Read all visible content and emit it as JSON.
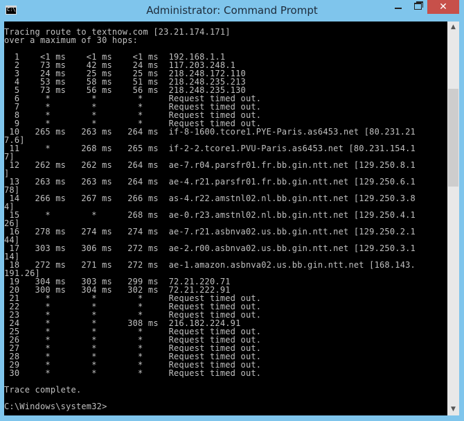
{
  "window": {
    "title": "Administrator: Command Prompt",
    "icon_label": "C:\\",
    "minimize_icon": "minimize-icon",
    "maximize_icon": "maximize-icon",
    "close_glyph": "✕"
  },
  "console": {
    "lines": [
      "Tracing route to textnow.com [23.21.174.171]",
      "over a maximum of 30 hops:",
      "",
      "  1    <1 ms    <1 ms    <1 ms  192.168.1.1",
      "  2    73 ms    42 ms    24 ms  117.203.248.1",
      "  3    24 ms    25 ms    25 ms  218.248.172.110",
      "  4    53 ms    58 ms    51 ms  218.248.235.213",
      "  5    73 ms    56 ms    56 ms  218.248.235.130",
      "  6     *        *        *     Request timed out.",
      "  7     *        *        *     Request timed out.",
      "  8     *        *        *     Request timed out.",
      "  9     *        *        *     Request timed out.",
      " 10   265 ms   263 ms   264 ms  if-8-1600.tcore1.PYE-Paris.as6453.net [80.231.21",
      "7.6]",
      " 11     *      268 ms   265 ms  if-2-2.tcore1.PVU-Paris.as6453.net [80.231.154.1",
      "7]",
      " 12   262 ms   262 ms   264 ms  ae-7.r04.parsfr01.fr.bb.gin.ntt.net [129.250.8.1",
      "]",
      " 13   263 ms   263 ms   264 ms  ae-4.r21.parsfr01.fr.bb.gin.ntt.net [129.250.6.1",
      "78]",
      " 14   266 ms   267 ms   266 ms  as-4.r22.amstnl02.nl.bb.gin.ntt.net [129.250.3.8",
      "4]",
      " 15     *        *      268 ms  ae-0.r23.amstnl02.nl.bb.gin.ntt.net [129.250.4.1",
      "26]",
      " 16   278 ms   274 ms   274 ms  ae-7.r21.asbnva02.us.bb.gin.ntt.net [129.250.2.1",
      "44]",
      " 17   303 ms   306 ms   272 ms  ae-2.r00.asbnva02.us.bb.gin.ntt.net [129.250.3.1",
      "14]",
      " 18   272 ms   271 ms   272 ms  ae-1.amazon.asbnva02.us.bb.gin.ntt.net [168.143.",
      "191.26]",
      " 19   304 ms   303 ms   299 ms  72.21.220.71",
      " 20   300 ms   304 ms   302 ms  72.21.222.91",
      " 21     *        *        *     Request timed out.",
      " 22     *        *        *     Request timed out.",
      " 23     *        *        *     Request timed out.",
      " 24     *        *      308 ms  216.182.224.91",
      " 25     *        *        *     Request timed out.",
      " 26     *        *        *     Request timed out.",
      " 27     *        *        *     Request timed out.",
      " 28     *        *        *     Request timed out.",
      " 29     *        *        *     Request timed out.",
      " 30     *        *        *     Request timed out.",
      "",
      "Trace complete.",
      "",
      "C:\\Windows\\system32>"
    ]
  },
  "scrollbar": {
    "up_glyph": "▲",
    "down_glyph": "▼"
  }
}
